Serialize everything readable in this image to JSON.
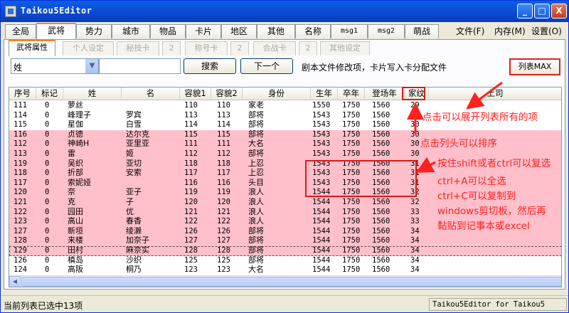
{
  "window": {
    "title": "Taikou5Editor",
    "minimize_label": "_",
    "maximize_label": "□",
    "close_label": "X"
  },
  "main_tabs": [
    "全局",
    "武将",
    "势力",
    "城市",
    "物品",
    "卡片",
    "地区",
    "其他",
    "名称",
    "msg1",
    "msg2",
    "萌战"
  ],
  "active_main_tab": "武将",
  "right_menu": [
    "文件(F)",
    "内存(M)",
    "设置(O)"
  ],
  "sub_tabs": [
    "武将属性",
    "个人设定",
    "秘技卡",
    "2",
    "称号卡",
    "2",
    "合战卡",
    "2",
    "其他设定"
  ],
  "search": {
    "field": "姓",
    "query": "",
    "search_button": "搜索",
    "next_button": "下一个"
  },
  "info_text": "剧本文件修改项，卡片写入卡分配文件",
  "list_max_button": "列表MAX",
  "columns": [
    "序号",
    "标记",
    "姓",
    "名",
    "容貌1",
    "容貌2",
    "身份",
    "生年",
    "卒年",
    "登场年",
    "家纹",
    "上司"
  ],
  "rows": [
    [
      "111",
      "0",
      "萝丝",
      "",
      "110",
      "110",
      "家老",
      "1550",
      "1750",
      "1560",
      "29",
      ""
    ],
    [
      "114",
      "0",
      "峰理子",
      "罗宾",
      "113",
      "113",
      "部将",
      "1543",
      "1750",
      "1560",
      "30",
      ""
    ],
    [
      "115",
      "0",
      "星伽",
      "白雪",
      "114",
      "114",
      "部将",
      "1543",
      "1750",
      "1560",
      "30",
      ""
    ],
    [
      "116",
      "0",
      "贞德",
      "达尔克",
      "115",
      "115",
      "部将",
      "1543",
      "1750",
      "1560",
      "30",
      ""
    ],
    [
      "112",
      "0",
      "神崎H",
      "亚里亚",
      "111",
      "111",
      "大名",
      "1543",
      "1750",
      "1560",
      "30",
      ""
    ],
    [
      "113",
      "0",
      "雷",
      "姬",
      "112",
      "112",
      "部将",
      "1543",
      "1750",
      "1560",
      "30",
      ""
    ],
    [
      "119",
      "0",
      "吴织",
      "亚切",
      "118",
      "118",
      "上忍",
      "1543",
      "1750",
      "1560",
      "31",
      ""
    ],
    [
      "118",
      "0",
      "折部",
      "安索",
      "117",
      "117",
      "上忍",
      "1543",
      "1750",
      "1560",
      "31",
      ""
    ],
    [
      "117",
      "0",
      "索妮娅",
      "",
      "116",
      "116",
      "头目",
      "1543",
      "1750",
      "1560",
      "31",
      ""
    ],
    [
      "120",
      "0",
      "奈",
      "亚子",
      "119",
      "119",
      "浪人",
      "1544",
      "1750",
      "1560",
      "32",
      ""
    ],
    [
      "121",
      "0",
      "克",
      "子",
      "120",
      "120",
      "浪人",
      "1544",
      "1750",
      "1560",
      "32",
      ""
    ],
    [
      "122",
      "0",
      "园田",
      "优",
      "121",
      "121",
      "浪人",
      "1544",
      "1750",
      "1560",
      "33",
      ""
    ],
    [
      "123",
      "0",
      "高山",
      "春香",
      "122",
      "122",
      "浪人",
      "1544",
      "1750",
      "1560",
      "33",
      ""
    ],
    [
      "127",
      "0",
      "新垣",
      "绫濑",
      "126",
      "126",
      "部将",
      "1544",
      "1750",
      "1560",
      "34",
      ""
    ],
    [
      "128",
      "0",
      "来楼",
      "加奈子",
      "127",
      "127",
      "部将",
      "1544",
      "1750",
      "1560",
      "34",
      ""
    ],
    [
      "129",
      "0",
      "田村",
      "麻奈实",
      "128",
      "128",
      "部将",
      "1544",
      "1750",
      "1560",
      "34",
      ""
    ],
    [
      "126",
      "0",
      "槙岛",
      "沙织",
      "125",
      "125",
      "部将",
      "1544",
      "1750",
      "1560",
      "34",
      ""
    ],
    [
      "124",
      "0",
      "高阪",
      "桐乃",
      "123",
      "123",
      "大名",
      "1544",
      "1750",
      "1560",
      "34",
      ""
    ]
  ],
  "selected_rows_label": "rows 4-16 selected",
  "status": {
    "left": "当前列表已选中13项",
    "right": "Taikou5Editor for Taikou5 1.1.X"
  },
  "annotations": {
    "expand": "点击可以展开列表所有的项",
    "sort": "点击列头可以排序",
    "multi": "按住shift或者ctrl可以复选",
    "select_all": "ctrl+A可以全选",
    "copy": "ctrl+C可以复制到",
    "paste1": "windows剪切板，然后再",
    "paste2": "黏贴到记事本或excel"
  },
  "colors": {
    "selection": "#ffc0cb",
    "annotation": "#ff2020",
    "title_bar": "#0a5fe8"
  }
}
